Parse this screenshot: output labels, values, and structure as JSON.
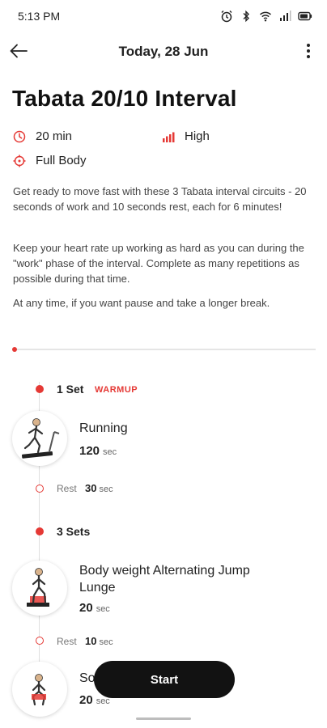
{
  "status_bar": {
    "time": "5:13 PM",
    "icons": [
      "alarm-icon",
      "bluetooth-icon",
      "wifi-icon",
      "signal-icon",
      "battery-icon"
    ]
  },
  "app_bar": {
    "title": "Today, 28 Jun",
    "back_icon": "arrow-left-icon",
    "more_icon": "more-vertical-icon"
  },
  "workout": {
    "title": "Tabata 20/10 Interval",
    "duration": "20 min",
    "intensity": "High",
    "focus": "Full Body",
    "description": [
      "Get ready to move fast with these 3 Tabata interval circuits - 20 seconds of work and 10 seconds rest, each for 6 minutes!",
      "Keep your heart rate up working as hard as you can during the \"work\" phase of the interval. Complete as many repetitions as possible during that time.",
      "At any time, if you want pause and take a longer break."
    ]
  },
  "colors": {
    "accent": "#e53935",
    "button_bg": "#121212"
  },
  "sets": [
    {
      "label": "1 Set",
      "tag": "WARMUP",
      "exercise": {
        "name": "Running",
        "duration": "120",
        "unit": "sec"
      },
      "rest": {
        "label": "Rest",
        "value": "30",
        "unit": "sec"
      }
    },
    {
      "label": "3 Sets",
      "exercise": {
        "name": "Body weight Alternating Jump Lunge",
        "duration": "20",
        "unit": "sec"
      },
      "rest": {
        "label": "Rest",
        "value": "10",
        "unit": "sec"
      },
      "next_exercise": {
        "name": "So",
        "duration": "20",
        "unit": "sec"
      }
    }
  ],
  "start_button": "Start"
}
